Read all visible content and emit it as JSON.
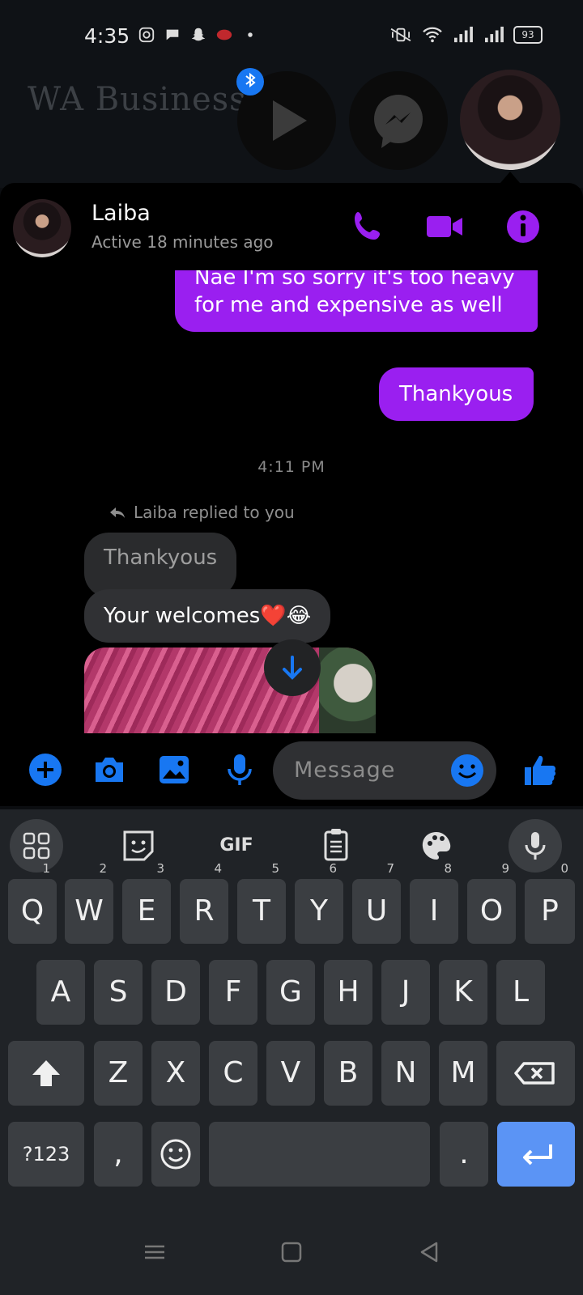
{
  "status_bar": {
    "time": "4:35",
    "battery": "93"
  },
  "home": {
    "widget_title": "WA Business"
  },
  "chat": {
    "contact_name": "Laiba",
    "contact_status": "Active 18 minutes ago",
    "messages": {
      "out_1": "Nae I'm so sorry it's too heavy for me and expensive as well",
      "out_2": "Thankyous",
      "timestamp": "4:11 PM",
      "reply_note": "Laiba replied to you",
      "quoted": "Thankyous",
      "in_1": "Your welcomes❤️😂"
    },
    "composer": {
      "placeholder": "Message"
    }
  },
  "keyboard": {
    "toolbar": {
      "gif_label": "GIF"
    },
    "row1": [
      {
        "k": "Q",
        "h": "1"
      },
      {
        "k": "W",
        "h": "2"
      },
      {
        "k": "E",
        "h": "3"
      },
      {
        "k": "R",
        "h": "4"
      },
      {
        "k": "T",
        "h": "5"
      },
      {
        "k": "Y",
        "h": "6"
      },
      {
        "k": "U",
        "h": "7"
      },
      {
        "k": "I",
        "h": "8"
      },
      {
        "k": "O",
        "h": "9"
      },
      {
        "k": "P",
        "h": "0"
      }
    ],
    "row2": [
      "A",
      "S",
      "D",
      "F",
      "G",
      "H",
      "J",
      "K",
      "L"
    ],
    "row3": [
      "Z",
      "X",
      "C",
      "V",
      "B",
      "N",
      "M"
    ],
    "bottom": {
      "sym_label": "?123",
      "comma": ",",
      "period": "."
    }
  },
  "colors": {
    "accent_purple": "#9a1ff0",
    "messenger_blue": "#1877f2",
    "enter_blue": "#5b94f5"
  }
}
